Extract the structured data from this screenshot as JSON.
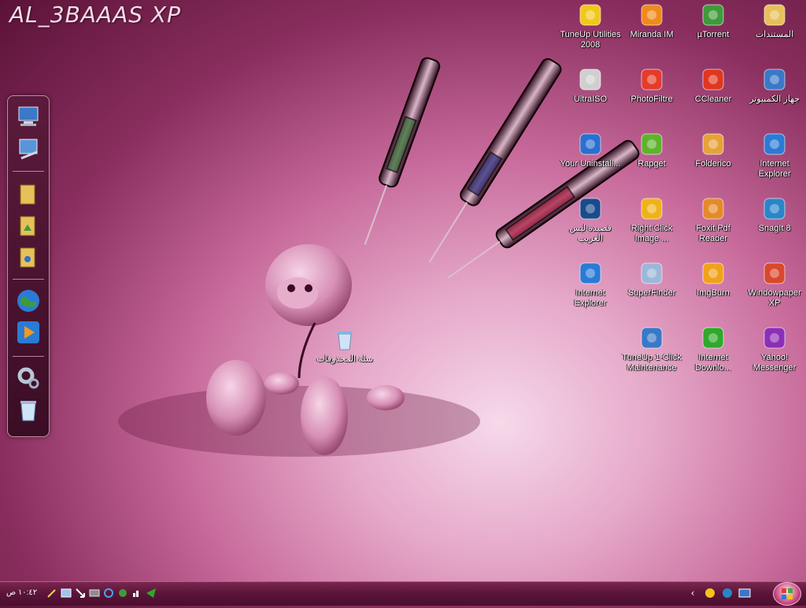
{
  "watermark": "AL_3BAAAS XP",
  "desktop_icons": [
    {
      "label": "TuneUp Utilities 2008",
      "icon": "tuneup-icon",
      "color": "#f2c81b"
    },
    {
      "label": "Miranda IM",
      "icon": "miranda-icon",
      "color": "#f08a1d"
    },
    {
      "label": "µTorrent",
      "icon": "utorrent-icon",
      "color": "#3f9b3a"
    },
    {
      "label": "المستندات",
      "icon": "folder-icon",
      "color": "#e6c15a"
    },
    {
      "label": "UltraISO",
      "icon": "disc-icon",
      "color": "#cfcfcf"
    },
    {
      "label": "PhotoFiltre",
      "icon": "photofiltre-icon",
      "color": "#e53b2a"
    },
    {
      "label": "CCleaner",
      "icon": "ccleaner-icon",
      "color": "#e0361f"
    },
    {
      "label": "جهاز الكمبيوتر",
      "icon": "computer-icon",
      "color": "#3a78c8"
    },
    {
      "label": "Your Uninstall...",
      "icon": "uninstaller-icon",
      "color": "#2b6fcf"
    },
    {
      "label": "Rapget",
      "icon": "download-arrow-icon",
      "color": "#5fb32c"
    },
    {
      "label": "Folderico",
      "icon": "folderico-icon",
      "color": "#e6a23a"
    },
    {
      "label": "Internet Explorer",
      "icon": "ie-icon",
      "color": "#2a7bd6"
    },
    {
      "label": "قصيدة ليس الغريب",
      "icon": "realplayer-icon",
      "color": "#1a4b8c"
    },
    {
      "label": "Right Click Image ...",
      "icon": "sun-icon",
      "color": "#f0b21a"
    },
    {
      "label": "Foxit Pdf Reader",
      "icon": "foxit-icon",
      "color": "#e58a2a"
    },
    {
      "label": "SnagIt 8",
      "icon": "snagit-icon",
      "color": "#2a85c9"
    },
    {
      "label": "Internet Explorer",
      "icon": "ie-icon",
      "color": "#2a7bd6"
    },
    {
      "label": "SuperFinder",
      "icon": "magnifier-icon",
      "color": "#9db7d8"
    },
    {
      "label": "ImgBurn",
      "icon": "burn-disc-icon",
      "color": "#f0a21a"
    },
    {
      "label": "Windowpaper XP",
      "icon": "windowpaper-icon",
      "color": "#d9482a"
    },
    {
      "label": "TuneUp 1-Click Maintenance",
      "icon": "maintenance-icon",
      "color": "#3a78c8"
    },
    {
      "label": "Internet Downlo...",
      "icon": "idm-icon",
      "color": "#2fa82b"
    },
    {
      "label": "Yahoo! Messenger",
      "icon": "yahoo-icon",
      "color": "#8c2fb8"
    },
    {
      "label": "سلة المحذوفات",
      "icon": "recycle-bin-icon",
      "color": "#7fb6e6"
    }
  ],
  "dock_icons": [
    "computer-icon",
    "network-icon",
    "folder-icon",
    "folder-icon",
    "folder-icon",
    "globe-icon",
    "media-player-icon",
    "settings-icon",
    "recycle-bin-icon"
  ],
  "taskbar": {
    "clock": "١٠:٤٢ ص",
    "tray_chevron": "‹"
  }
}
